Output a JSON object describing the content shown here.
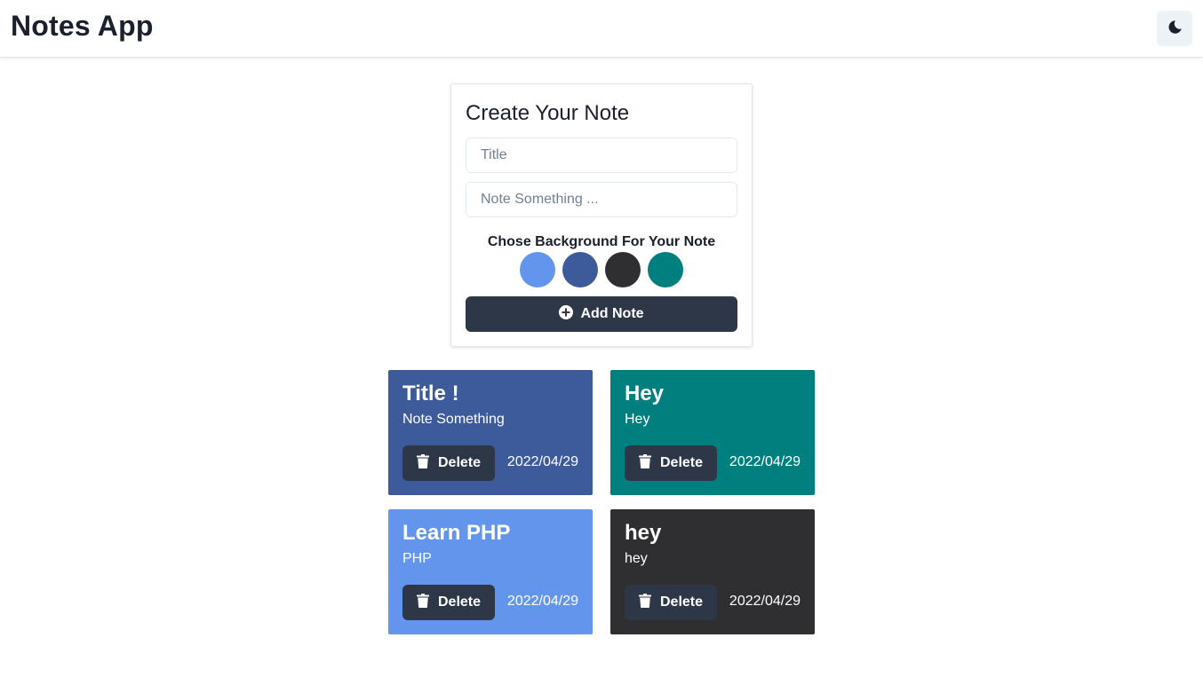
{
  "app": {
    "title": "Notes App",
    "theme_toggle_icon": "moon-icon"
  },
  "create": {
    "heading": "Create Your Note",
    "title_placeholder": "Title",
    "note_placeholder": "Note Something ...",
    "background_label": "Chose Background For Your Note",
    "swatch_colors": [
      "#6495ed",
      "#3d5a9b",
      "#2f2f31",
      "#007f7f"
    ],
    "add_button_label": "Add Note",
    "add_button_icon": "plus-circle-icon"
  },
  "notes": [
    {
      "title": "Title !",
      "body": "Note Something",
      "date": "2022/04/29",
      "color": "#3d5a9b",
      "delete_label": "Delete"
    },
    {
      "title": "Hey",
      "body": "Hey",
      "date": "2022/04/29",
      "color": "#007f7f",
      "delete_label": "Delete"
    },
    {
      "title": "Learn PHP",
      "body": "PHP",
      "date": "2022/04/29",
      "color": "#6495ed",
      "delete_label": "Delete"
    },
    {
      "title": "hey",
      "body": "hey",
      "date": "2022/04/29",
      "color": "#2f2f31",
      "delete_label": "Delete"
    }
  ]
}
